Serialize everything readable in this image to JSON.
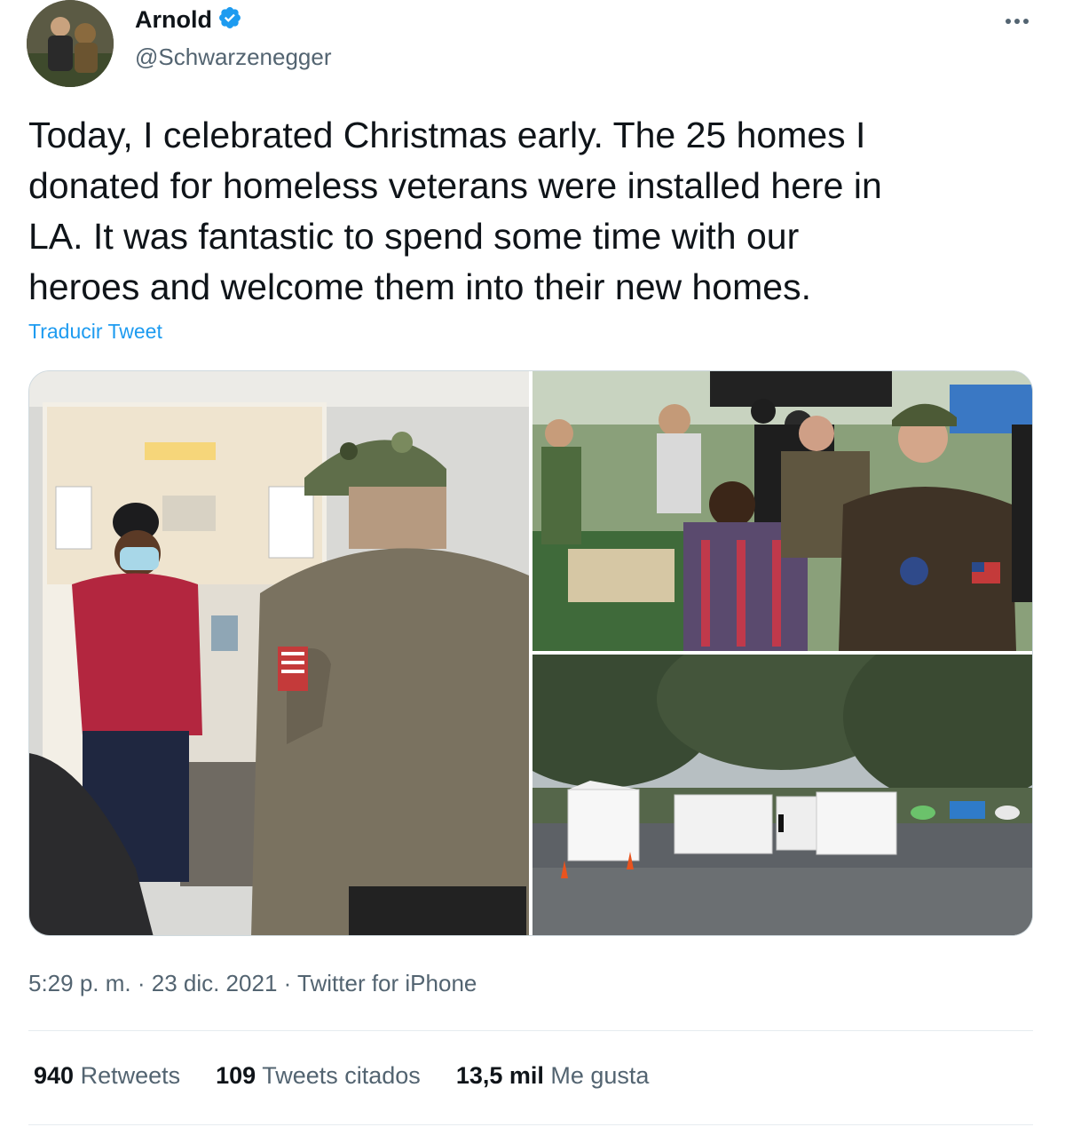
{
  "author": {
    "display_name": "Arnold",
    "handle": "@Schwarzenegger"
  },
  "icons": {
    "verified": "verified-badge-icon",
    "more": "more-options-icon"
  },
  "colors": {
    "accent": "#1d9bf0",
    "text": "#0f1419",
    "secondary": "#536471"
  },
  "tweet": {
    "lines": [
      "Today, I celebrated Christmas early. The 25 homes I",
      "donated for homeless veterans were installed here in",
      "LA. It was fantastic to spend some time with our",
      "heroes and welcome them into their new homes."
    ],
    "translate_label": "Traducir Tweet"
  },
  "meta": {
    "time": "5:29 p. m.",
    "separator": " · ",
    "date": "23 dic. 2021",
    "source": "Twitter for iPhone"
  },
  "stats": [
    {
      "count": "940",
      "label": "Retweets"
    },
    {
      "count": "109",
      "label": "Tweets citados"
    },
    {
      "count": "13,5 mil",
      "label": "Me gusta"
    }
  ]
}
